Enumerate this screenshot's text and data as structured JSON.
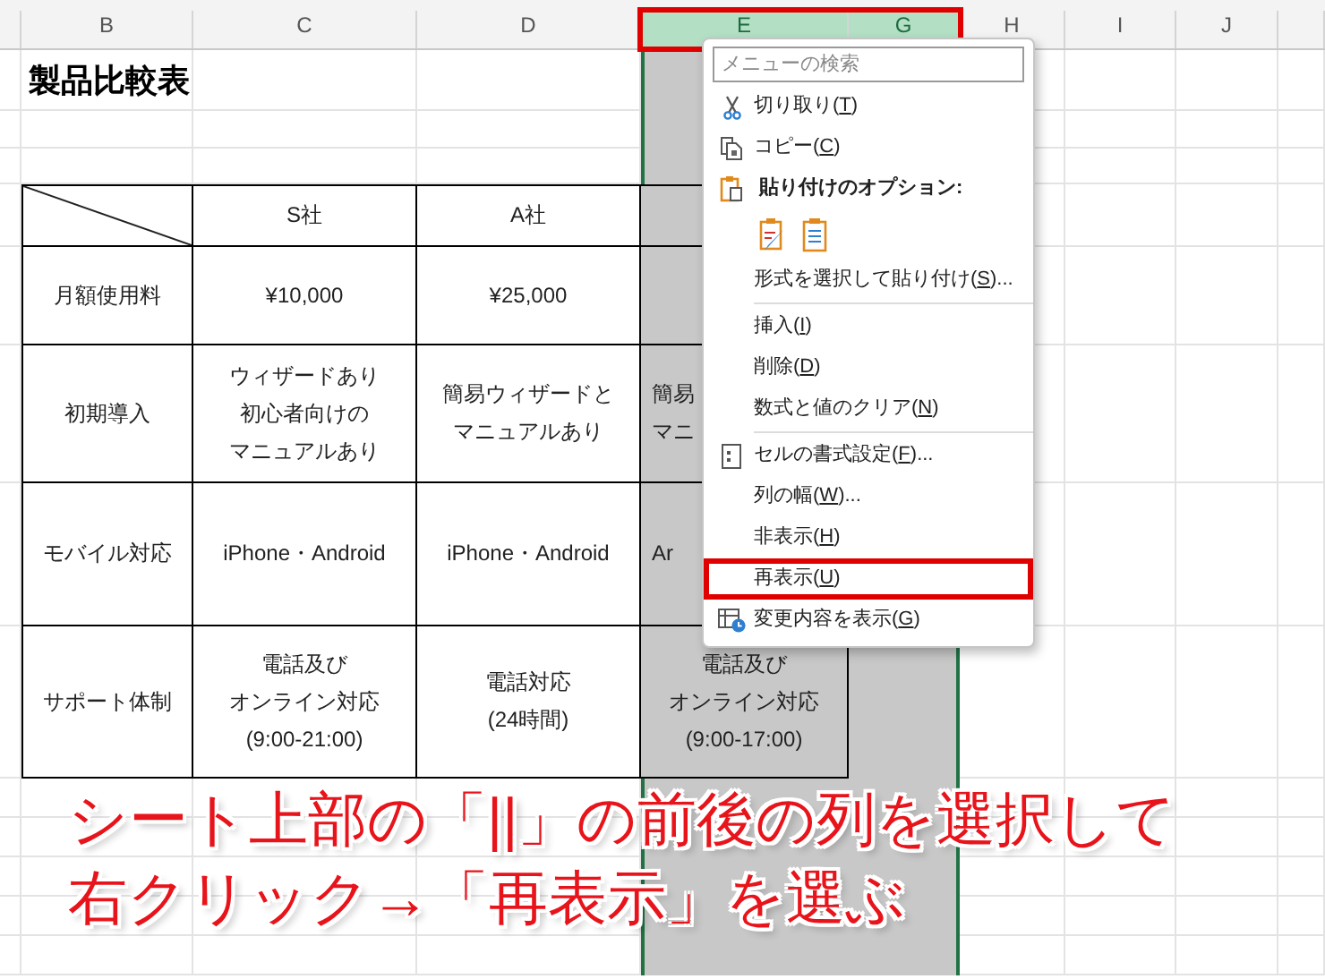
{
  "columns": [
    {
      "label": "B",
      "selected": false,
      "outlined": false
    },
    {
      "label": "C",
      "selected": false,
      "outlined": false
    },
    {
      "label": "D",
      "selected": false,
      "outlined": false
    },
    {
      "label": "E",
      "selected": true,
      "outlined": true
    },
    {
      "label": "G",
      "selected": true,
      "outlined": true
    },
    {
      "label": "H",
      "selected": false,
      "outlined": false
    },
    {
      "label": "I",
      "selected": false,
      "outlined": false
    },
    {
      "label": "J",
      "selected": false,
      "outlined": false
    }
  ],
  "sheet_title": "製品比較表",
  "comparison_table": {
    "companies": [
      "S社",
      "A社"
    ],
    "rows": [
      {
        "label": "月額使用料",
        "cells": [
          {
            "lines": [
              "¥10,000"
            ],
            "partial": false
          },
          {
            "lines": [
              "¥25,000"
            ],
            "partial": false
          }
        ]
      },
      {
        "label": "初期導入",
        "cells": [
          {
            "lines": [
              "ウィザードあり",
              "初心者向けの",
              "マニュアルあり"
            ],
            "partial": false
          },
          {
            "lines": [
              "簡易ウィザードと",
              "マニュアルあり"
            ],
            "partial": false
          },
          {
            "lines": [
              "簡易",
              "マニ"
            ],
            "partial": true
          }
        ]
      },
      {
        "label": "モバイル対応",
        "cells": [
          {
            "lines": [
              "iPhone・Android"
            ],
            "partial": false
          },
          {
            "lines": [
              "iPhone・Android"
            ],
            "partial": false
          },
          {
            "lines": [
              "Ar"
            ],
            "partial": true
          }
        ]
      },
      {
        "label": "サポート体制",
        "cells": [
          {
            "lines": [
              "電話及び",
              "オンライン対応",
              "(9:00-21:00)"
            ],
            "partial": false
          },
          {
            "lines": [
              "電話対応",
              "(24時間)"
            ],
            "partial": false
          },
          {
            "lines": [
              "電話及び",
              "オンライン対応",
              "(9:00-17:00)"
            ],
            "partial": false
          }
        ]
      }
    ]
  },
  "context_menu": {
    "search_placeholder": "メニューの検索",
    "items": [
      {
        "kind": "command",
        "prefix": "切り取り(",
        "key": "T",
        "suffix": ")",
        "highlighted": false
      },
      {
        "kind": "command",
        "prefix": "コピー(",
        "key": "C",
        "suffix": ")",
        "highlighted": false
      },
      {
        "kind": "heading",
        "text": "貼り付けのオプション:"
      },
      {
        "kind": "paste_options"
      },
      {
        "kind": "command",
        "prefix": "形式を選択して貼り付け(",
        "key": "S",
        "suffix": ")...",
        "highlighted": false
      },
      {
        "kind": "separator"
      },
      {
        "kind": "command",
        "prefix": "挿入(",
        "key": "I",
        "suffix": ")",
        "highlighted": false
      },
      {
        "kind": "command",
        "prefix": "削除(",
        "key": "D",
        "suffix": ")",
        "highlighted": false
      },
      {
        "kind": "command",
        "prefix": "数式と値のクリア(",
        "key": "N",
        "suffix": ")",
        "highlighted": false
      },
      {
        "kind": "separator"
      },
      {
        "kind": "command",
        "prefix": "セルの書式設定(",
        "key": "F",
        "suffix": ")...",
        "highlighted": false
      },
      {
        "kind": "command",
        "prefix": "列の幅(",
        "key": "W",
        "suffix": ")...",
        "highlighted": false
      },
      {
        "kind": "command",
        "prefix": "非表示(",
        "key": "H",
        "suffix": ")",
        "highlighted": false
      },
      {
        "kind": "command",
        "prefix": "再表示(",
        "key": "U",
        "suffix": ")",
        "highlighted": true
      },
      {
        "kind": "command",
        "prefix": "変更内容を表示(",
        "key": "G",
        "suffix": ")",
        "highlighted": false
      }
    ]
  },
  "annotation": {
    "lines": [
      "シート上部の「||」の前後の列を選択して",
      "右クリック→「再表示」を選ぶ"
    ]
  }
}
